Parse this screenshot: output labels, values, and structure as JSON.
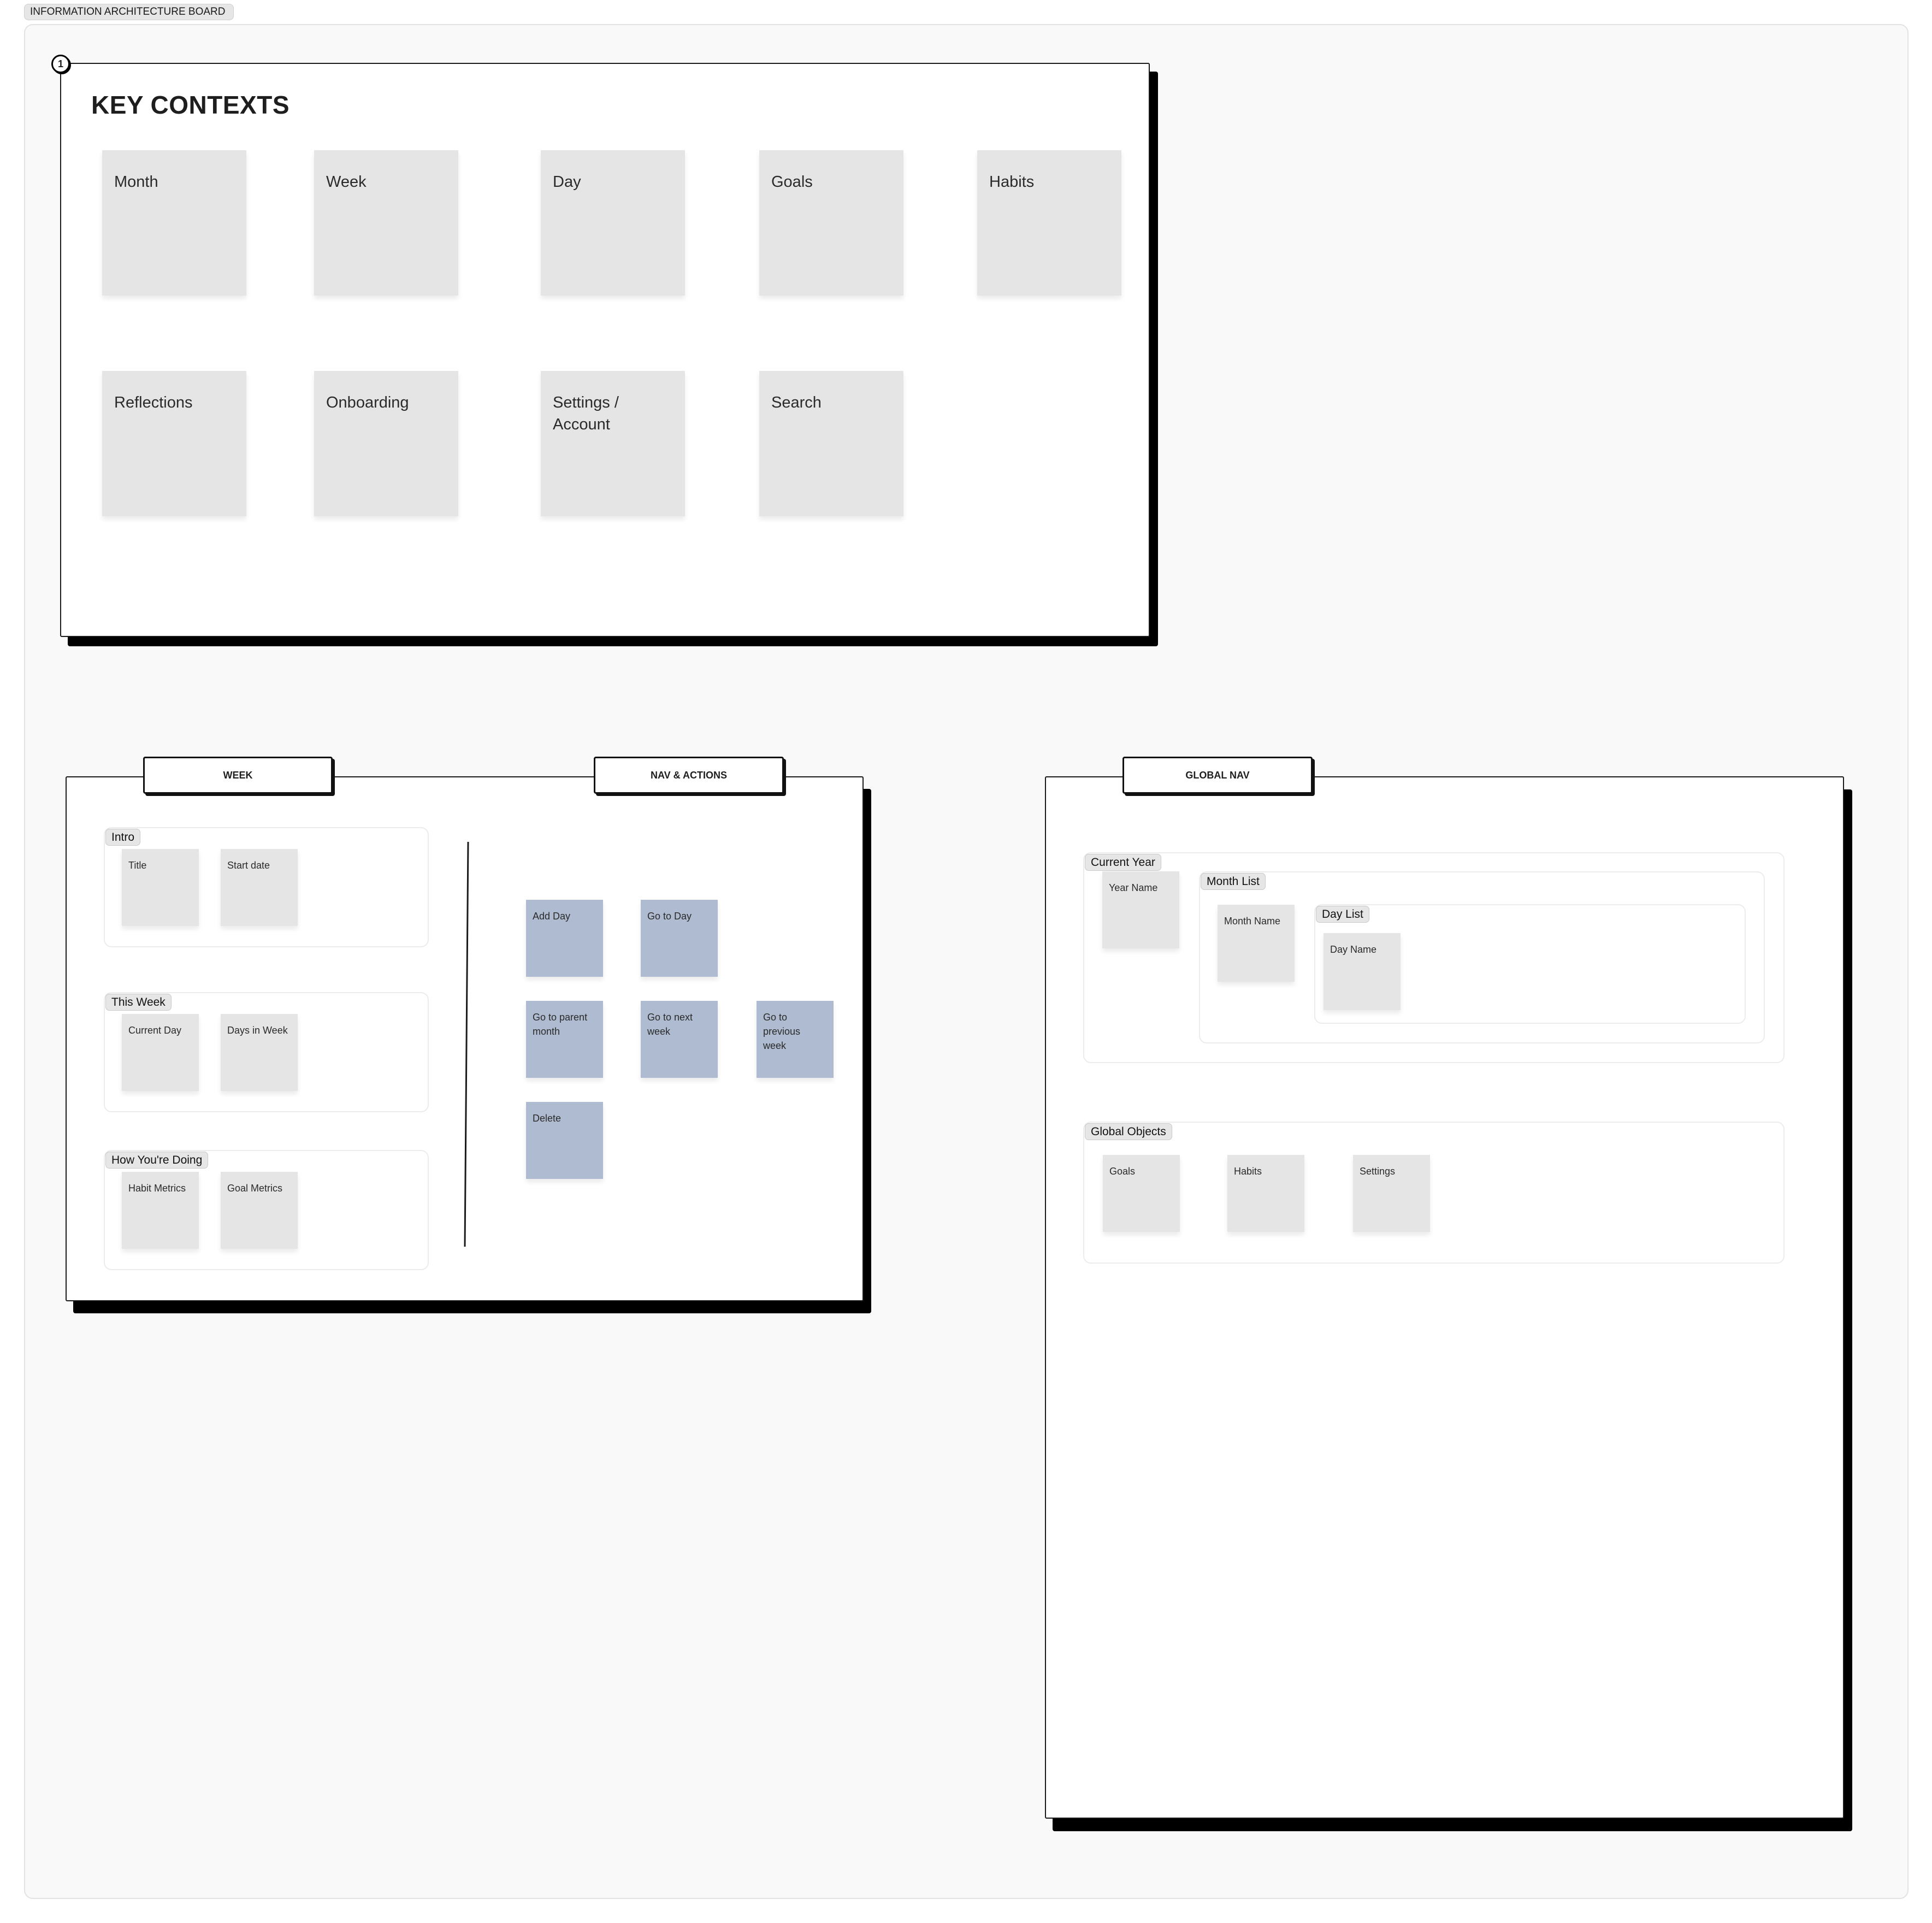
{
  "board": {
    "label": "INFORMATION ARCHITECTURE BOARD"
  },
  "key_contexts": {
    "frame_number": "1",
    "title": "KEY CONTEXTS",
    "cards": [
      {
        "label": "Month"
      },
      {
        "label": "Week"
      },
      {
        "label": "Day"
      },
      {
        "label": "Goals"
      },
      {
        "label": "Habits"
      },
      {
        "label": "Reflections"
      },
      {
        "label": "Onboarding"
      },
      {
        "label": "Settings / Account"
      },
      {
        "label": "Search"
      }
    ]
  },
  "week_panel": {
    "tab_label": "WEEK",
    "nav_tab_label": "NAV & ACTIONS",
    "groups": [
      {
        "label": "Intro",
        "cards": [
          "Title",
          "Start date"
        ]
      },
      {
        "label": "This Week",
        "cards": [
          "Current Day",
          "Days in Week"
        ]
      },
      {
        "label": "How You're Doing",
        "cards": [
          "Habit Metrics",
          "Goal Metrics"
        ]
      }
    ],
    "actions": [
      "Add Day",
      "Go to Day",
      "Go to parent month",
      "Go to next week",
      "Go to previous week",
      "Delete"
    ]
  },
  "global_nav": {
    "tab_label": "GLOBAL NAV",
    "current_year": {
      "label": "Current Year",
      "year_card": "Year Name",
      "month_list": {
        "label": "Month List",
        "month_card": "Month Name",
        "day_list": {
          "label": "Day List",
          "day_card": "Day Name"
        }
      }
    },
    "global_objects": {
      "label": "Global Objects",
      "cards": [
        "Goals",
        "Habits",
        "Settings"
      ]
    }
  },
  "colors": {
    "sticky_grey": "#e5e5e5",
    "sticky_blue": "#aebbd0",
    "frame_border": "#1a1a1a",
    "canvas": "#f9f9f9"
  }
}
